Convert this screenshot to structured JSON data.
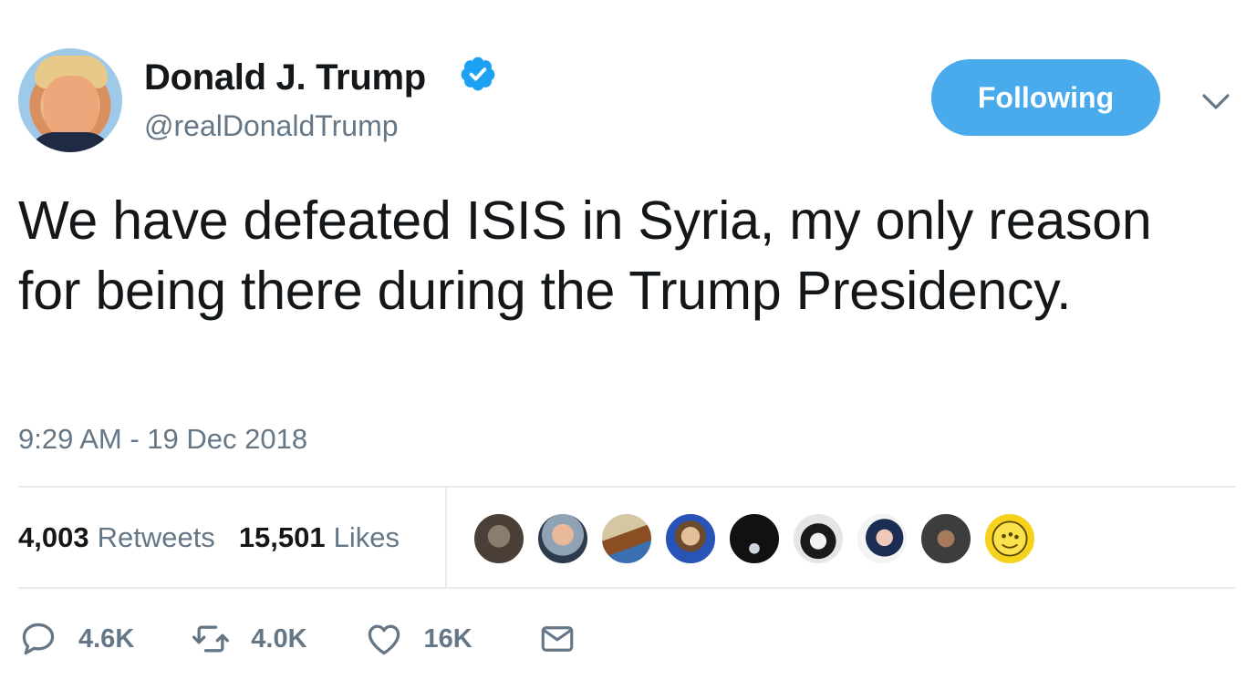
{
  "author": {
    "display_name": "Donald J. Trump",
    "handle": "@realDonaldTrump",
    "verified": true
  },
  "follow_button": {
    "label": "Following",
    "color": "#4aabec"
  },
  "tweet": {
    "text": "We have defeated ISIS in Syria, my only reason for being there during the Trump Presidency.",
    "timestamp": "9:29 AM - 19 Dec 2018"
  },
  "stats": {
    "retweets_count": "4,003",
    "retweets_label": "Retweets",
    "likes_count": "15,501",
    "likes_label": "Likes"
  },
  "likers": [
    {
      "icon": "liker-avatar-statue"
    },
    {
      "icon": "liker-avatar-man"
    },
    {
      "icon": "liker-avatar-gavel"
    },
    {
      "icon": "liker-avatar-portrait"
    },
    {
      "icon": "liker-avatar-dark"
    },
    {
      "icon": "liker-avatar-bw-face"
    },
    {
      "icon": "liker-avatar-woman"
    },
    {
      "icon": "liker-avatar-figure"
    },
    {
      "icon": "liker-avatar-emoji"
    }
  ],
  "actions": {
    "reply_count": "4.6K",
    "retweet_count": "4.0K",
    "like_count": "16K"
  },
  "colors": {
    "accent": "#1da1f2",
    "secondary_text": "#657786",
    "divider": "#e6ecf0"
  }
}
